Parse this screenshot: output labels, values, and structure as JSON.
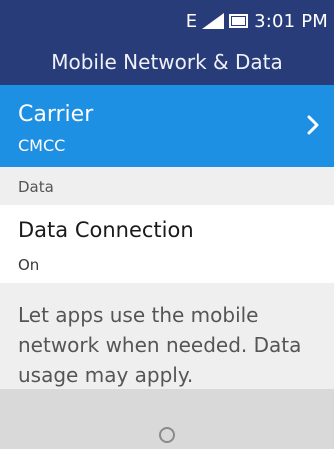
{
  "status_bar": {
    "network_type": "E",
    "signal_icon": "signal-icon",
    "battery_icon": "battery-icon",
    "time": "3:01 PM"
  },
  "header": {
    "title": "Mobile Network & Data"
  },
  "carrier": {
    "title": "Carrier",
    "value": "CMCC",
    "chevron_icon": "chevron-right-icon"
  },
  "section": {
    "label": "Data"
  },
  "data_connection": {
    "title": "Data Connection",
    "value": "On"
  },
  "description": {
    "text": "Let apps use the mobile network when needed. Data usage may apply."
  },
  "softkeys": {
    "center_icon": "center-softkey-circle-icon"
  },
  "colors": {
    "header_bg": "#293c7a",
    "selected_bg": "#1e90e3",
    "section_bg": "#efefef",
    "softkey_bg": "#d9d9d9"
  }
}
